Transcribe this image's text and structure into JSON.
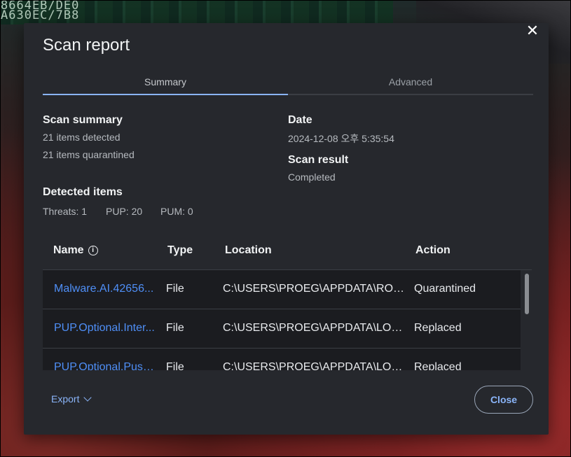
{
  "background": {
    "text_lines": [
      "8664EB/DE0",
      "A630EC/7B8"
    ]
  },
  "dialog": {
    "title": "Scan report",
    "close_icon": "close-icon",
    "tabs": [
      {
        "label": "Summary",
        "active": true
      },
      {
        "label": "Advanced",
        "active": false
      }
    ],
    "summary": {
      "heading": "Scan summary",
      "detected": "21 items detected",
      "quarantined": "21 items quarantined"
    },
    "date": {
      "heading": "Date",
      "value": "2024-12-08 오후 5:35:54"
    },
    "result": {
      "heading": "Scan result",
      "value": "Completed"
    },
    "detected_items": {
      "heading": "Detected items",
      "threats": "Threats: 1",
      "pup": "PUP: 20",
      "pum": "PUM: 0"
    },
    "table": {
      "columns": {
        "name": "Name",
        "type": "Type",
        "location": "Location",
        "action": "Action"
      },
      "rows": [
        {
          "name": "Malware.AI.42656...",
          "type": "File",
          "location": "C:\\USERS\\PROEG\\APPDATA\\ROA...",
          "action": "Quarantined"
        },
        {
          "name": "PUP.Optional.Inter...",
          "type": "File",
          "location": "C:\\USERS\\PROEG\\APPDATA\\LOCA...",
          "action": "Replaced"
        },
        {
          "name": "PUP.Optional.Push...",
          "type": "File",
          "location": "C:\\USERS\\PROEG\\APPDATA\\LOCA...",
          "action": "Replaced"
        }
      ]
    },
    "footer": {
      "export_label": "Export",
      "close_label": "Close"
    }
  },
  "colors": {
    "dialog_bg": "#26282d",
    "table_bg": "#1b1c20",
    "accent": "#8ab4f8",
    "link": "#4f8ff7"
  }
}
